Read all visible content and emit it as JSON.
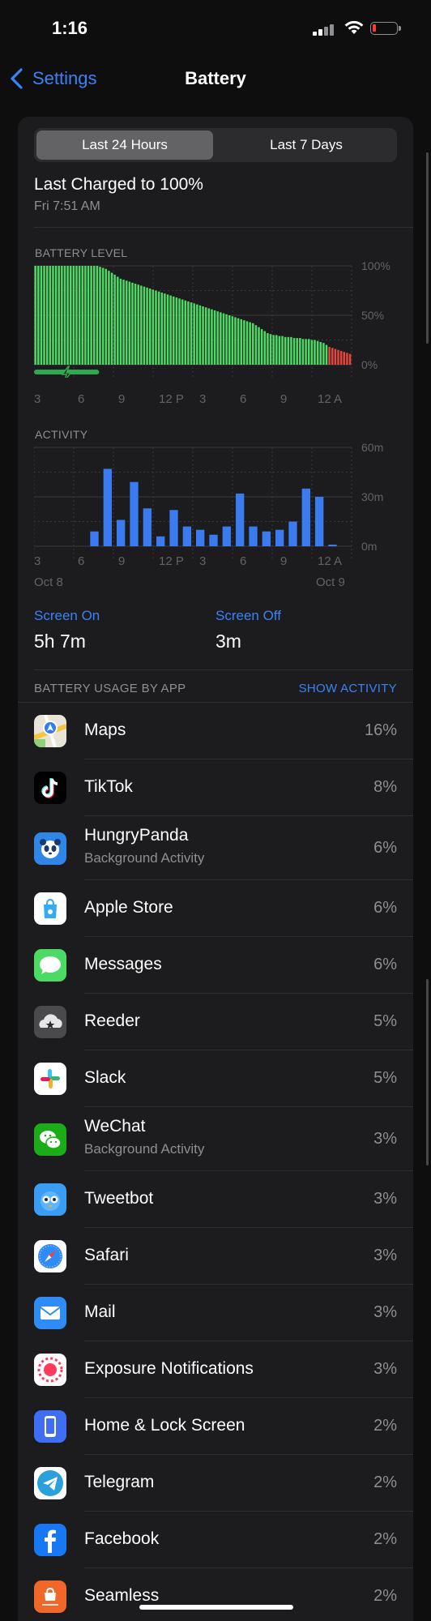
{
  "status": {
    "time": "1:16"
  },
  "nav": {
    "back_label": "Settings",
    "title": "Battery"
  },
  "segments": {
    "active": "Last 24 Hours",
    "inactive": "Last 7 Days"
  },
  "last_charged": {
    "title": "Last Charged to 100%",
    "date": "Fri 7:51 AM"
  },
  "battery_chart": {
    "label": "BATTERY LEVEL",
    "y_labels": [
      "100%",
      "50%",
      "0%"
    ],
    "x_labels": [
      "3",
      "6",
      "9",
      "12 P",
      "3",
      "6",
      "9",
      "12 A"
    ]
  },
  "activity_chart": {
    "label": "ACTIVITY",
    "y_labels": [
      "60m",
      "30m",
      "0m"
    ],
    "x_labels": [
      "3",
      "6",
      "9",
      "12 P",
      "3",
      "6",
      "9",
      "12 A"
    ],
    "date_start": "Oct 8",
    "date_end": "Oct 9"
  },
  "chart_data": [
    {
      "type": "bar",
      "title": "BATTERY LEVEL",
      "ylim": [
        0,
        100
      ],
      "y_ticks": [
        "100%",
        "50%",
        "0%"
      ],
      "x_ticks": [
        "3",
        "6",
        "9",
        "12 P",
        "3",
        "6",
        "9",
        "12 A"
      ],
      "values": [
        100,
        100,
        100,
        100,
        100,
        100,
        100,
        100,
        100,
        100,
        100,
        100,
        100,
        100,
        100,
        100,
        100,
        100,
        100,
        100,
        100,
        100,
        99,
        98,
        97,
        95,
        93,
        91,
        89,
        87,
        86,
        85,
        84,
        83,
        82,
        81,
        80,
        79,
        78,
        77,
        76,
        75,
        74,
        73,
        72,
        71,
        70,
        69,
        68,
        67,
        66,
        65,
        64,
        63,
        62,
        61,
        60,
        59,
        58,
        57,
        56,
        55,
        54,
        53,
        52,
        51,
        50,
        49,
        48,
        47,
        46,
        45,
        44,
        43,
        42,
        40,
        38,
        36,
        34,
        32,
        31,
        30,
        30,
        29,
        29,
        28,
        28,
        28,
        27,
        27,
        27,
        26,
        26,
        26,
        25,
        25,
        24,
        23,
        22,
        20,
        18,
        17,
        16,
        15,
        14,
        13,
        12,
        11
      ],
      "low_color": "#e5453a",
      "high_color": "#4cd964",
      "charging_color": "#2fa84f"
    },
    {
      "type": "bar",
      "title": "ACTIVITY",
      "ylim": [
        0,
        60
      ],
      "y_ticks": [
        "60m",
        "30m",
        "0m"
      ],
      "x_ticks": [
        "3",
        "6",
        "9",
        "12 P",
        "3",
        "6",
        "9",
        "12 A"
      ],
      "values": [
        0,
        0,
        0,
        0,
        9,
        47,
        16,
        39,
        23,
        6,
        22,
        12,
        10,
        7,
        12,
        32,
        12,
        9,
        10,
        15,
        35,
        30,
        1,
        0
      ],
      "color": "#3a7bf0"
    }
  ],
  "screen": {
    "on_label": "Screen On",
    "on_value": "5h 7m",
    "off_label": "Screen Off",
    "off_value": "3m"
  },
  "usage": {
    "header": "BATTERY USAGE BY APP",
    "show_activity": "SHOW ACTIVITY",
    "apps": [
      {
        "name": "Maps",
        "sub": "",
        "pct": "16%",
        "icon": "maps-icon"
      },
      {
        "name": "TikTok",
        "sub": "",
        "pct": "8%",
        "icon": "tiktok-icon"
      },
      {
        "name": "HungryPanda",
        "sub": "Background Activity",
        "pct": "6%",
        "icon": "hungrypanda-icon"
      },
      {
        "name": "Apple Store",
        "sub": "",
        "pct": "6%",
        "icon": "apple-store-icon"
      },
      {
        "name": "Messages",
        "sub": "",
        "pct": "6%",
        "icon": "messages-icon"
      },
      {
        "name": "Reeder",
        "sub": "",
        "pct": "5%",
        "icon": "reeder-icon"
      },
      {
        "name": "Slack",
        "sub": "",
        "pct": "5%",
        "icon": "slack-icon"
      },
      {
        "name": "WeChat",
        "sub": "Background Activity",
        "pct": "3%",
        "icon": "wechat-icon"
      },
      {
        "name": "Tweetbot",
        "sub": "",
        "pct": "3%",
        "icon": "tweetbot-icon"
      },
      {
        "name": "Safari",
        "sub": "",
        "pct": "3%",
        "icon": "safari-icon"
      },
      {
        "name": "Mail",
        "sub": "",
        "pct": "3%",
        "icon": "mail-icon"
      },
      {
        "name": "Exposure Notifications",
        "sub": "",
        "pct": "3%",
        "icon": "exposure-notifications-icon"
      },
      {
        "name": "Home & Lock Screen",
        "sub": "",
        "pct": "2%",
        "icon": "home-lock-screen-icon"
      },
      {
        "name": "Telegram",
        "sub": "",
        "pct": "2%",
        "icon": "telegram-icon"
      },
      {
        "name": "Facebook",
        "sub": "",
        "pct": "2%",
        "icon": "facebook-icon"
      },
      {
        "name": "Seamless",
        "sub": "",
        "pct": "2%",
        "icon": "seamless-icon"
      }
    ]
  }
}
